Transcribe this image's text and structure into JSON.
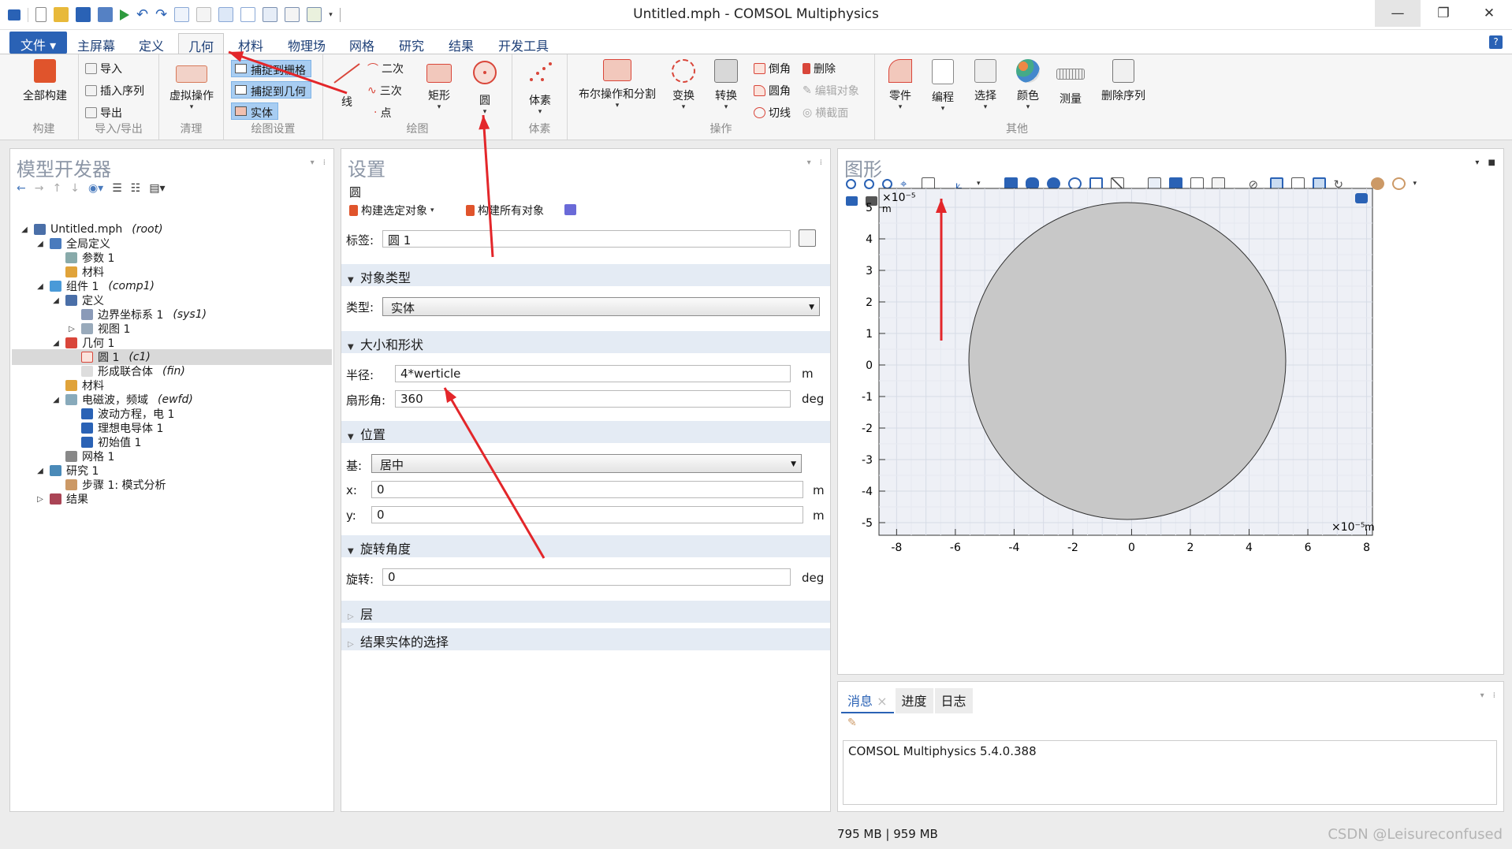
{
  "window": {
    "title": "Untitled.mph - COMSOL Multiphysics",
    "minimize": "—",
    "restore": "❐",
    "close": "✕"
  },
  "quick_access": [
    "window-icon",
    "new-icon",
    "open-icon",
    "save-icon",
    "save-as-icon",
    "run-icon",
    "undo-icon",
    "redo-icon",
    "copy-icon",
    "paste-icon",
    "duplicate-icon",
    "delete-icon",
    "select-icon",
    "select-all-icon",
    "windows-icon"
  ],
  "menu_tabs": {
    "file": "文件 ▾",
    "home": "主屏幕",
    "definitions": "定义",
    "geometry": "几何",
    "materials": "材料",
    "physics": "物理场",
    "mesh": "网格",
    "study": "研究",
    "results": "结果",
    "developer": "开发工具",
    "help": "?"
  },
  "ribbon": {
    "build": {
      "label": "全部构建",
      "group": "构建"
    },
    "importexport": {
      "import": "导入",
      "insert_sequence": "插入序列",
      "export": "导出",
      "group": "导入/导出"
    },
    "cleanup": {
      "virtual_ops": "虚拟操作",
      "group": "清理"
    },
    "draw_settings": {
      "snap_grid": "捕捉到栅格",
      "snap_geometry": "捕捉到几何",
      "solid": "实体",
      "group": "绘图设置"
    },
    "draw": {
      "line": "线",
      "quadratic": "二次",
      "cubic": "三次",
      "point": "点",
      "rectangle": "矩形",
      "circle": "圆",
      "group": "绘图"
    },
    "voxels": {
      "label": "体素",
      "group": "体素"
    },
    "operations": {
      "boolean": "布尔操作和分割",
      "transform": "变换",
      "convert": "转换",
      "chamfer": "倒角",
      "fillet": "圆角",
      "tangent": "切线",
      "delete": "删除",
      "edit_object": "编辑对象",
      "cross_section": "横截面",
      "group": "操作"
    },
    "other": {
      "parts": "零件",
      "programming": "编程",
      "selection": "选择",
      "color": "颜色",
      "measure": "测量",
      "delete_sequence": "删除序列",
      "group": "其他"
    }
  },
  "model_builder": {
    "title": "模型开发器",
    "tree": [
      {
        "label": "Untitled.mph",
        "tag": "(root)",
        "toggle": "◢",
        "icon": "model-icon"
      },
      {
        "label": "全局定义",
        "tag": "",
        "toggle": "◢",
        "icon": "globe-icon"
      },
      {
        "label": "参数 1",
        "tag": "",
        "toggle": "",
        "icon": "parameters-icon"
      },
      {
        "label": "材料",
        "tag": "",
        "toggle": "",
        "icon": "materials-icon"
      },
      {
        "label": "组件 1",
        "tag": "(comp1)",
        "toggle": "◢",
        "icon": "component-icon"
      },
      {
        "label": "定义",
        "tag": "",
        "toggle": "◢",
        "icon": "definitions-icon"
      },
      {
        "label": "边界坐标系 1",
        "tag": "(sys1)",
        "toggle": "",
        "icon": "coordinate-system-icon"
      },
      {
        "label": "视图 1",
        "tag": "",
        "toggle": "▷",
        "icon": "view-icon"
      },
      {
        "label": "几何 1",
        "tag": "",
        "toggle": "◢",
        "icon": "geometry-icon"
      },
      {
        "label": "圆 1",
        "tag": "(c1)",
        "toggle": "",
        "icon": "circle-icon"
      },
      {
        "label": "形成联合体",
        "tag": "(fin)",
        "toggle": "",
        "icon": "form-union-icon"
      },
      {
        "label": "材料",
        "tag": "",
        "toggle": "",
        "icon": "materials-icon"
      },
      {
        "label": "电磁波，频域",
        "tag": "(ewfd)",
        "toggle": "◢",
        "icon": "em-waves-icon"
      },
      {
        "label": "波动方程，电 1",
        "tag": "",
        "toggle": "",
        "icon": "wave-equation-icon"
      },
      {
        "label": "理想电导体 1",
        "tag": "",
        "toggle": "",
        "icon": "pec-icon"
      },
      {
        "label": "初始值 1",
        "tag": "",
        "toggle": "",
        "icon": "initial-values-icon"
      },
      {
        "label": "网格 1",
        "tag": "",
        "toggle": "",
        "icon": "mesh-icon"
      },
      {
        "label": "研究 1",
        "tag": "",
        "toggle": "◢",
        "icon": "study-icon"
      },
      {
        "label": "步骤 1: 模式分析",
        "tag": "",
        "toggle": "",
        "icon": "step-icon"
      },
      {
        "label": "结果",
        "tag": "",
        "toggle": "▷",
        "icon": "results-icon"
      }
    ]
  },
  "settings": {
    "title": "设置",
    "node_type": "圆",
    "build_selected": "构建选定对象",
    "build_all": "构建所有对象",
    "label_label": "标签:",
    "label_value": "圆 1",
    "sections": {
      "object_type": "对象类型",
      "size_shape": "大小和形状",
      "position": "位置",
      "rotation": "旋转角度",
      "layers": "层",
      "resulting": "结果实体的选择"
    },
    "type_label": "类型:",
    "type_value": "实体",
    "radius_label": "半径:",
    "radius_value": "4*werticle",
    "radius_unit": "m",
    "sector_label": "扇形角:",
    "sector_value": "360",
    "sector_unit": "deg",
    "base_label": "基:",
    "base_value": "居中",
    "x_label": "x:",
    "x_value": "0",
    "x_unit": "m",
    "y_label": "y:",
    "y_value": "0",
    "y_unit": "m",
    "rotation_label": "旋转:",
    "rotation_value": "0",
    "rotation_unit": "deg"
  },
  "graphics": {
    "title": "图形",
    "y_scale": "×10⁻⁵",
    "y_unit": "m",
    "x_scale": "×10⁻⁵",
    "x_unit": "m",
    "y_ticks": [
      "5",
      "4",
      "3",
      "2",
      "1",
      "0",
      "-1",
      "-2",
      "-3",
      "-4",
      "-5"
    ],
    "x_ticks": [
      "-8",
      "-6",
      "-4",
      "-2",
      "0",
      "2",
      "4",
      "6",
      "8"
    ],
    "circle_color": "#c8c8c8"
  },
  "messages": {
    "tab_messages": "消息",
    "tab_close": "×",
    "tab_progress": "进度",
    "tab_log": "日志",
    "text": "COMSOL Multiphysics 5.4.0.388"
  },
  "status": {
    "memory": "795 MB | 959 MB",
    "watermark": "CSDN @Leisureconfused"
  },
  "colors": {
    "accent": "#2a62b5",
    "arrow": "#e3262a",
    "selection": "#a8cdf2"
  }
}
